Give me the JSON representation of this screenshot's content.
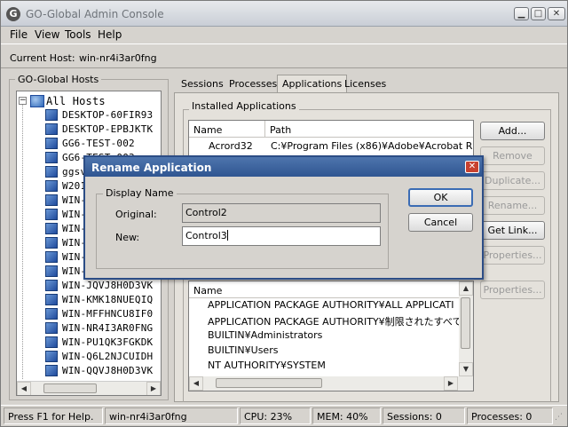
{
  "window": {
    "title": "GO-Global Admin Console",
    "app_icon_glyph": "G"
  },
  "menu": [
    "File",
    "View",
    "Tools",
    "Help"
  ],
  "host": {
    "label": "Current Host:",
    "value": "win-nr4i3ar0fng"
  },
  "hosts_panel": {
    "title": "GO-Global Hosts",
    "root": "All Hosts",
    "items": [
      "DESKTOP-60FIR93",
      "DESKTOP-EPBJKTK",
      "GG6-TEST-002",
      "GG6-TEST-003",
      "ggsv",
      "W201",
      "WIN-",
      "WIN-",
      "WIN-",
      "WIN-",
      "WIN-",
      "WIN-",
      "WIN-JQVJ8H0D3VK",
      "WIN-KMK18NUEQIQ",
      "WIN-MFFHNCU8IF0",
      "WIN-NR4I3AR0FNG",
      "WIN-PU1QK3FGKDK",
      "WIN-Q6L2NJCUIDH",
      "WIN-QQVJ8H0D3VK"
    ]
  },
  "tabs": [
    "Sessions",
    "Processes",
    "Applications",
    "Licenses"
  ],
  "active_tab": "Applications",
  "installed_apps": {
    "title": "Installed Applications",
    "columns": [
      "Name",
      "Path"
    ],
    "rows": [
      {
        "name": "Acrord32",
        "path": "C:¥Program Files (x86)¥Adobe¥Acrobat R"
      }
    ]
  },
  "app_buttons": {
    "add": "Add...",
    "remove": "Remove",
    "duplicate": "Duplicate...",
    "rename": "Rename...",
    "get_link": "Get Link...",
    "properties": "Properties..."
  },
  "permissions": {
    "column": "Name",
    "rows": [
      "APPLICATION PACKAGE AUTHORITY¥ALL APPLICATI",
      "APPLICATION PACKAGE AUTHORITY¥制限されたすべて",
      "BUILTIN¥Administrators",
      "BUILTIN¥Users",
      "NT AUTHORITY¥SYSTEM"
    ],
    "properties_button": "Properties..."
  },
  "dialog": {
    "title": "Rename Application",
    "group_title": "Display Name",
    "original_label": "Original:",
    "original_value": "Control2",
    "new_label": "New:",
    "new_value": "Control3",
    "ok": "OK",
    "cancel": "Cancel",
    "close_glyph": "✕"
  },
  "status": {
    "help": "Press F1 for Help.",
    "host": "win-nr4i3ar0fng",
    "cpu": "CPU: 23%",
    "mem": "MEM: 40%",
    "sessions": "Sessions: 0",
    "processes": "Processes: 0"
  }
}
